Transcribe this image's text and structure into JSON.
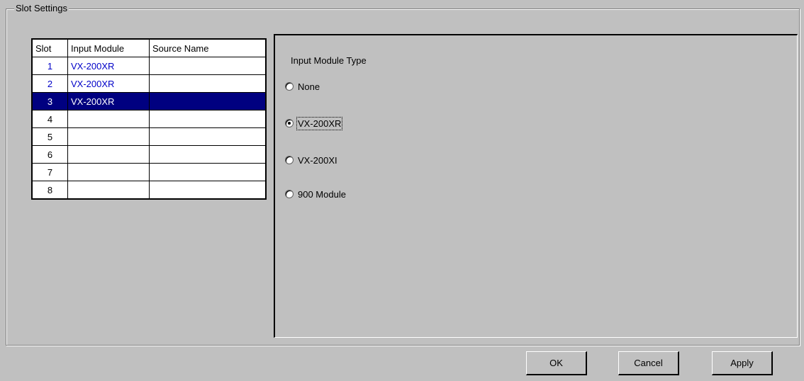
{
  "group": {
    "title": "Slot Settings"
  },
  "table": {
    "headers": [
      "Slot",
      "Input Module",
      "Source Name"
    ],
    "rows": [
      {
        "slot": "1",
        "module": "VX-200XR",
        "source": ""
      },
      {
        "slot": "2",
        "module": "VX-200XR",
        "source": ""
      },
      {
        "slot": "3",
        "module": "VX-200XR",
        "source": "",
        "selected": true
      },
      {
        "slot": "4",
        "module": "",
        "source": ""
      },
      {
        "slot": "5",
        "module": "",
        "source": ""
      },
      {
        "slot": "6",
        "module": "",
        "source": ""
      },
      {
        "slot": "7",
        "module": "",
        "source": ""
      },
      {
        "slot": "8",
        "module": "",
        "source": ""
      }
    ]
  },
  "module_type": {
    "title": "Input Module Type",
    "options": [
      {
        "label": "None",
        "checked": false
      },
      {
        "label": "VX-200XR",
        "checked": true
      },
      {
        "label": "VX-200XI",
        "checked": false
      },
      {
        "label": "900 Module",
        "checked": false
      }
    ]
  },
  "buttons": {
    "ok": "OK",
    "cancel": "Cancel",
    "apply": "Apply"
  },
  "colors": {
    "selection": "#000080",
    "module_text": "#0000c8",
    "face": "#c0c0c0"
  }
}
